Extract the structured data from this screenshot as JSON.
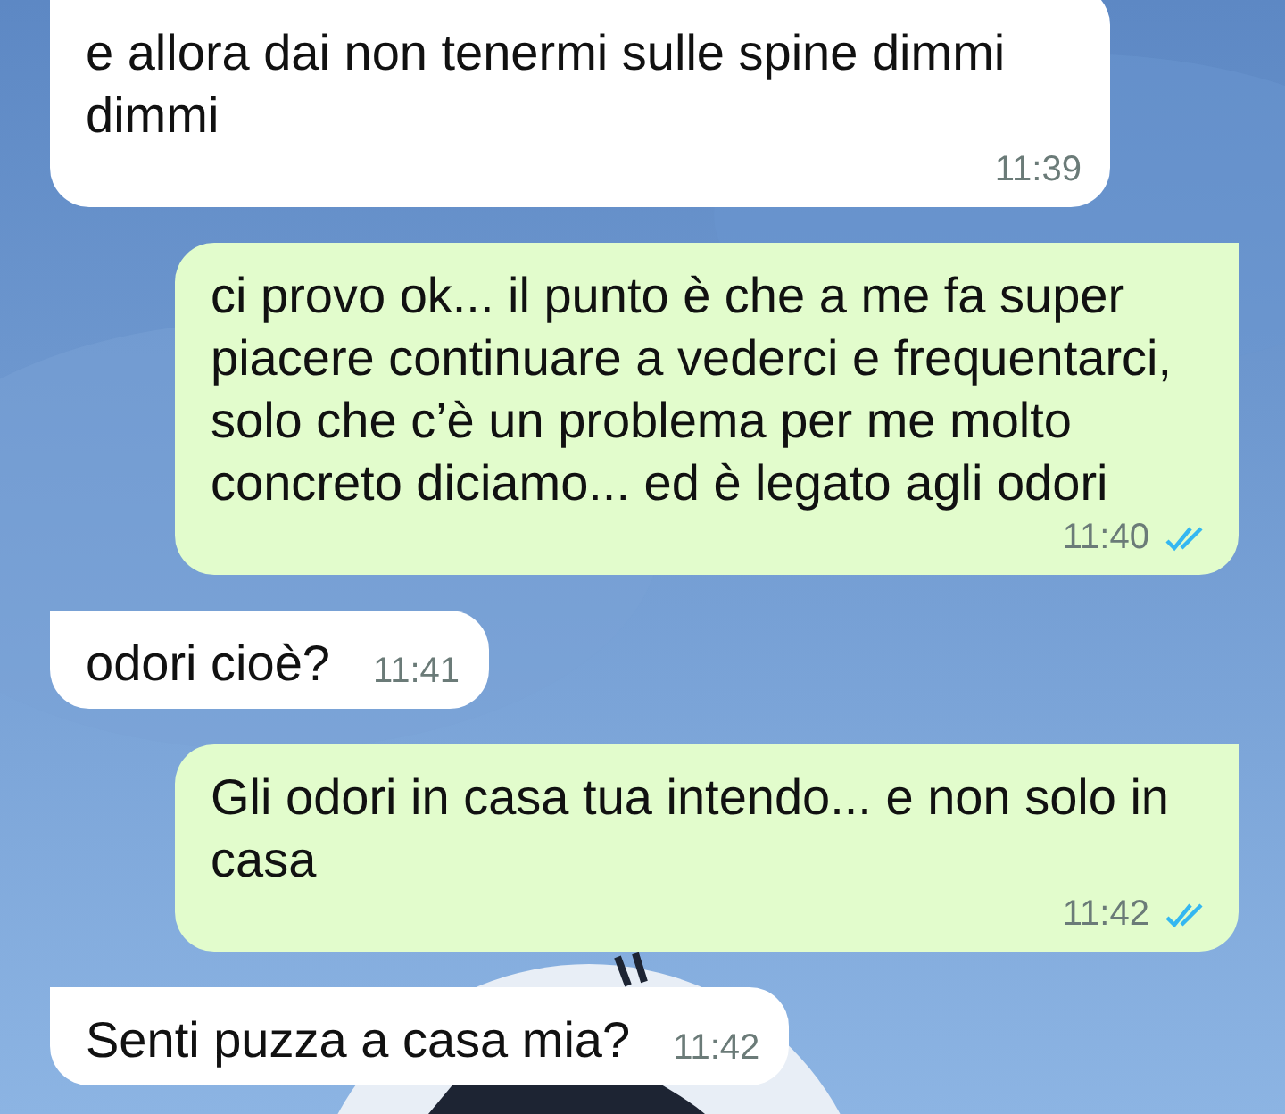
{
  "messages": [
    {
      "kind": "incoming",
      "text": "e allora dai non tenermi sulle spine dimmi dimmi",
      "time": "11:39"
    },
    {
      "kind": "outgoing",
      "text": "ci provo ok... il punto è che a me fa super piacere continuare a vederci e frequentarci, solo che c’è un problema per me molto concreto diciamo... ed è legato agli odori",
      "time": "11:40",
      "read": true
    },
    {
      "kind": "incoming",
      "text": "odori cioè?",
      "time": "11:41"
    },
    {
      "kind": "outgoing",
      "text": "Gli odori in casa tua intendo... e non solo in casa",
      "time": "11:42",
      "read": true
    },
    {
      "kind": "incoming",
      "text": "Senti puzza a casa mia?",
      "time": "11:42"
    }
  ]
}
